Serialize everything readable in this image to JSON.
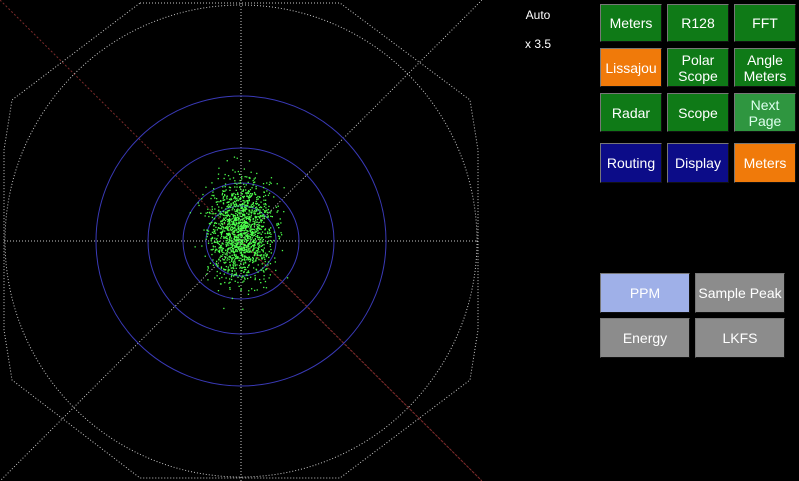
{
  "scope": {
    "mode_label": "Auto",
    "zoom_label": "x 3.5",
    "colors": {
      "grid": "#c8c8c8",
      "rings": "#3a3ab8",
      "diagonal_dim": "#7a2a2a",
      "points": "#4cff4c"
    }
  },
  "grid_buttons": [
    {
      "label": "Meters",
      "style": "green"
    },
    {
      "label": "R128",
      "style": "green"
    },
    {
      "label": "FFT",
      "style": "green"
    },
    {
      "label": "Lissajou",
      "style": "orange"
    },
    {
      "label": "Polar\nScope",
      "style": "green"
    },
    {
      "label": "Angle\nMeters",
      "style": "green"
    },
    {
      "label": "Radar",
      "style": "green"
    },
    {
      "label": "Scope",
      "style": "green"
    },
    {
      "label": "Next\nPage",
      "style": "green-light"
    },
    {
      "label": "Routing",
      "style": "navy"
    },
    {
      "label": "Display",
      "style": "navy"
    },
    {
      "label": "Meters",
      "style": "orange"
    }
  ],
  "meter_buttons": [
    {
      "label": "PPM",
      "style": "periwinkle"
    },
    {
      "label": "Sample Peak",
      "style": "gray"
    },
    {
      "label": "Energy",
      "style": "gray"
    },
    {
      "label": "LKFS",
      "style": "gray"
    }
  ]
}
